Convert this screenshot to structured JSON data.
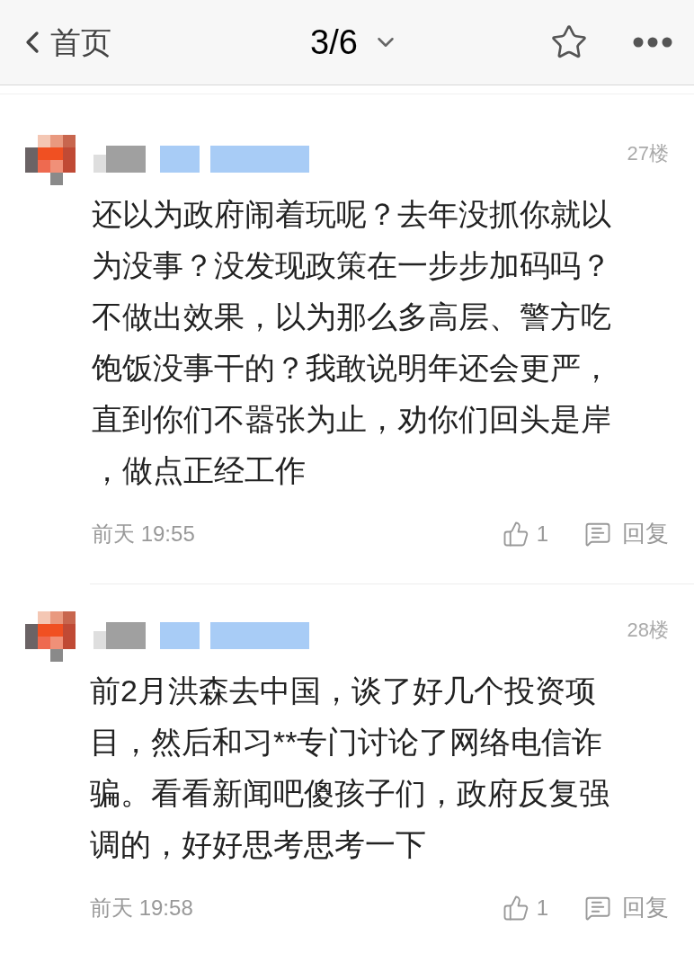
{
  "header": {
    "back_label": "首页",
    "page_indicator": "3/6"
  },
  "comments": [
    {
      "floor": "27楼",
      "lines": [
        "还以为政府闹着玩呢？去年没抓你就以",
        "为没事？没发现政策在一步步加码吗？",
        "不做出效果，以为那么多高层、警方吃",
        "饱饭没事干的？我敢说明年还会更严，",
        "直到你们不嚣张为止，劝你们回头是岸",
        "，做点正经工作"
      ],
      "time": "前天 19:55",
      "likes": "1",
      "reply_label": "回复"
    },
    {
      "floor": "28楼",
      "lines": [
        "前2月洪森去中国，谈了好几个投资项",
        "目，然后和习**专门讨论了网络电信诈",
        "骗。看看新闻吧傻孩子们，政府反复强",
        "调的，好好思考思考一下"
      ],
      "time": "前天 19:58",
      "likes": "1",
      "reply_label": "回复"
    }
  ]
}
